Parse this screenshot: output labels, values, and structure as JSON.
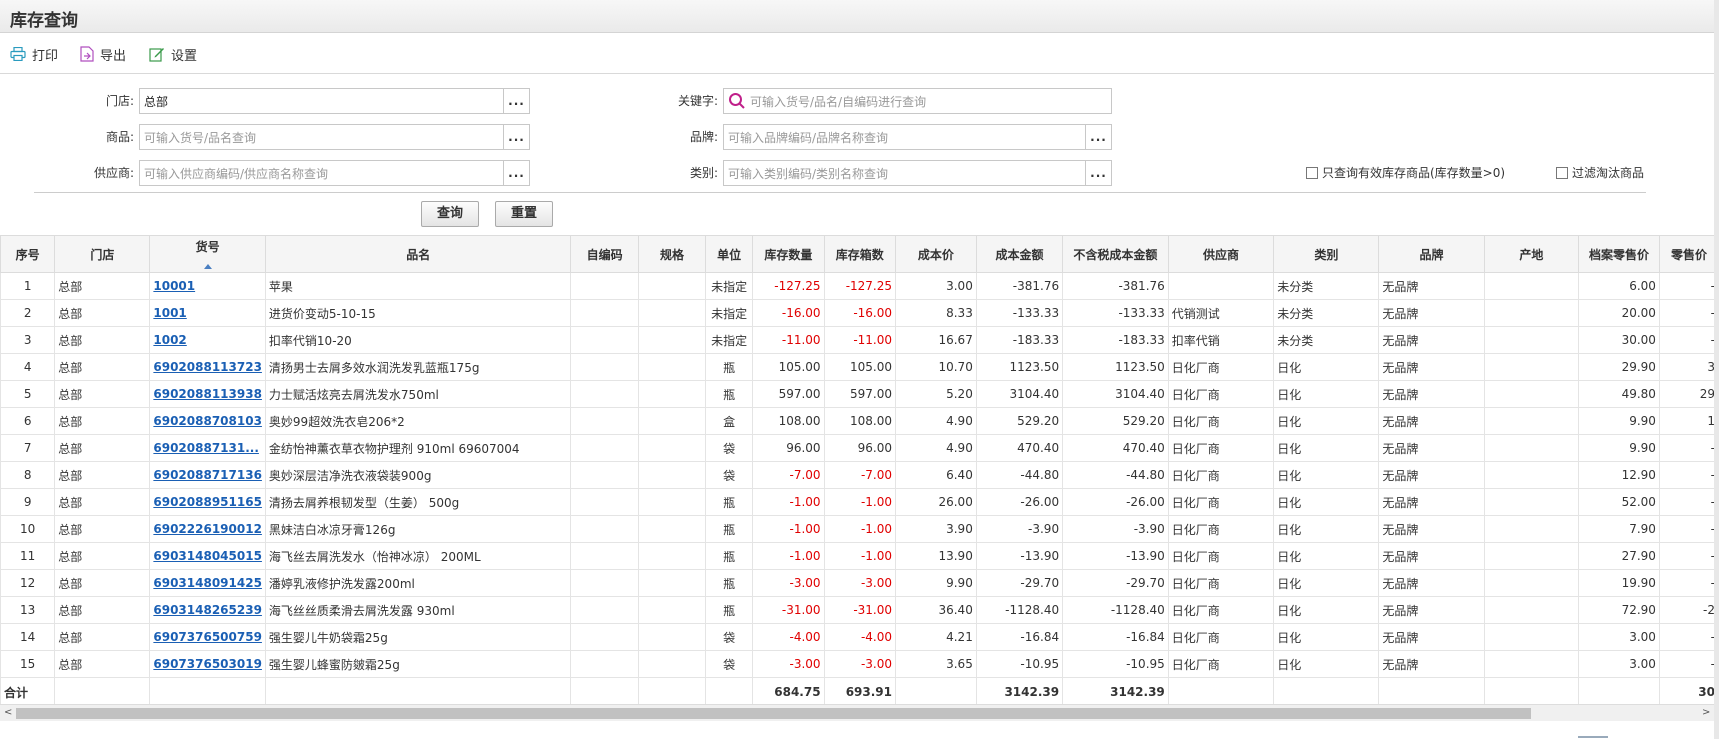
{
  "page": {
    "title": "库存查询"
  },
  "toolbar": {
    "print": "打印",
    "export": "导出",
    "settings": "设置"
  },
  "filters": {
    "store_label": "门店:",
    "store_value": "总部",
    "product_label": "商品:",
    "product_placeholder": "可输入货号/品名查询",
    "supplier_label": "供应商:",
    "supplier_placeholder": "可输入供应商编码/供应商名称查询",
    "keyword_label": "关键字:",
    "keyword_placeholder": "可输入货号/品名/自编码进行查询",
    "brand_label": "品牌:",
    "brand_placeholder": "可输入品牌编码/品牌名称查询",
    "category_label": "类别:",
    "category_placeholder": "可输入类别编码/类别名称查询",
    "only_valid_label": "只查询有效库存商品(库存数量>0)",
    "filter_eliminated_label": "过滤淘汰商品",
    "more_icon": "..."
  },
  "buttons": {
    "query": "查询",
    "reset": "重置"
  },
  "table": {
    "columns": [
      "序号",
      "门店",
      "货号",
      "品名",
      "自编码",
      "规格",
      "单位",
      "库存数量",
      "库存箱数",
      "成本价",
      "成本金额",
      "不含税成本金额",
      "供应商",
      "类别",
      "品牌",
      "产地",
      "档案零售价",
      "零售价"
    ],
    "rows": [
      [
        "1",
        "总部",
        "10001",
        "苹果",
        "",
        "",
        "未指定",
        "-127.25",
        "-127.25",
        "3.00",
        "-381.76",
        "-381.76",
        "",
        "未分类",
        "无品牌",
        "",
        "6.00",
        "-"
      ],
      [
        "2",
        "总部",
        "1001",
        "进货价变动5-10-15",
        "",
        "",
        "未指定",
        "-16.00",
        "-16.00",
        "8.33",
        "-133.33",
        "-133.33",
        "代销测试",
        "未分类",
        "无品牌",
        "",
        "20.00",
        "-"
      ],
      [
        "3",
        "总部",
        "1002",
        "扣率代销10-20",
        "",
        "",
        "未指定",
        "-11.00",
        "-11.00",
        "16.67",
        "-183.33",
        "-183.33",
        "扣率代销",
        "未分类",
        "无品牌",
        "",
        "30.00",
        "-"
      ],
      [
        "4",
        "总部",
        "6902088113723",
        "清扬男士去屑多效水润洗发乳蓝瓶175g",
        "",
        "",
        "瓶",
        "105.00",
        "105.00",
        "10.70",
        "1123.50",
        "1123.50",
        "日化厂商",
        "日化",
        "无品牌",
        "",
        "29.90",
        "3"
      ],
      [
        "5",
        "总部",
        "6902088113938",
        "力士赋活炫亮去屑洗发水750ml",
        "",
        "",
        "瓶",
        "597.00",
        "597.00",
        "5.20",
        "3104.40",
        "3104.40",
        "日化厂商",
        "日化",
        "无品牌",
        "",
        "49.80",
        "29"
      ],
      [
        "6",
        "总部",
        "6902088708103",
        "奥妙99超效洗衣皂206*2",
        "",
        "",
        "盒",
        "108.00",
        "108.00",
        "4.90",
        "529.20",
        "529.20",
        "日化厂商",
        "日化",
        "无品牌",
        "",
        "9.90",
        "1"
      ],
      [
        "7",
        "总部",
        "69020887131...",
        "金纺怡神薰衣草衣物护理剂 910ml 69607004",
        "",
        "",
        "袋",
        "96.00",
        "96.00",
        "4.90",
        "470.40",
        "470.40",
        "日化厂商",
        "日化",
        "无品牌",
        "",
        "9.90",
        "-"
      ],
      [
        "8",
        "总部",
        "6902088717136",
        "奥妙深层洁净洗衣液袋装900g",
        "",
        "",
        "袋",
        "-7.00",
        "-7.00",
        "6.40",
        "-44.80",
        "-44.80",
        "日化厂商",
        "日化",
        "无品牌",
        "",
        "12.90",
        "-"
      ],
      [
        "9",
        "总部",
        "6902088951165",
        "清扬去屑养根韧发型（生姜） 500g",
        "",
        "",
        "瓶",
        "-1.00",
        "-1.00",
        "26.00",
        "-26.00",
        "-26.00",
        "日化厂商",
        "日化",
        "无品牌",
        "",
        "52.00",
        "-"
      ],
      [
        "10",
        "总部",
        "6902226190012",
        "黑妹洁白冰凉牙膏126g",
        "",
        "",
        "瓶",
        "-1.00",
        "-1.00",
        "3.90",
        "-3.90",
        "-3.90",
        "日化厂商",
        "日化",
        "无品牌",
        "",
        "7.90",
        "-"
      ],
      [
        "11",
        "总部",
        "6903148045015",
        "海飞丝去屑洗发水（怡神冰凉） 200ML",
        "",
        "",
        "瓶",
        "-1.00",
        "-1.00",
        "13.90",
        "-13.90",
        "-13.90",
        "日化厂商",
        "日化",
        "无品牌",
        "",
        "27.90",
        "-"
      ],
      [
        "12",
        "总部",
        "6903148091425",
        "潘婷乳液修护洗发露200ml",
        "",
        "",
        "瓶",
        "-3.00",
        "-3.00",
        "9.90",
        "-29.70",
        "-29.70",
        "日化厂商",
        "日化",
        "无品牌",
        "",
        "19.90",
        "-"
      ],
      [
        "13",
        "总部",
        "6903148265239",
        "海飞丝丝质柔滑去屑洗发露 930ml",
        "",
        "",
        "瓶",
        "-31.00",
        "-31.00",
        "36.40",
        "-1128.40",
        "-1128.40",
        "日化厂商",
        "日化",
        "无品牌",
        "",
        "72.90",
        "-2"
      ],
      [
        "14",
        "总部",
        "6907376500759",
        "强生婴儿牛奶袋霜25g",
        "",
        "",
        "袋",
        "-4.00",
        "-4.00",
        "4.21",
        "-16.84",
        "-16.84",
        "日化厂商",
        "日化",
        "无品牌",
        "",
        "3.00",
        "-"
      ],
      [
        "15",
        "总部",
        "6907376503019",
        "强生婴儿蜂蜜防皴霜25g",
        "",
        "",
        "袋",
        "-3.00",
        "-3.00",
        "3.65",
        "-10.95",
        "-10.95",
        "日化厂商",
        "日化",
        "无品牌",
        "",
        "3.00",
        "-"
      ]
    ],
    "summary": [
      "合计",
      "",
      "",
      "",
      "",
      "",
      "",
      "684.75",
      "693.91",
      "",
      "3142.39",
      "3142.39",
      "",
      "",
      "",
      "",
      "",
      "30"
    ]
  },
  "scrollbar": {
    "left_arrow": "<",
    "right_arrow": ">"
  },
  "colors": {
    "link": "#1a5fb4",
    "negative": "#e00000",
    "print_icon": "#2a9bbf",
    "export_icon": "#b04fbf",
    "settings_icon": "#3a9a4a",
    "search_icon": "#c0208a"
  }
}
